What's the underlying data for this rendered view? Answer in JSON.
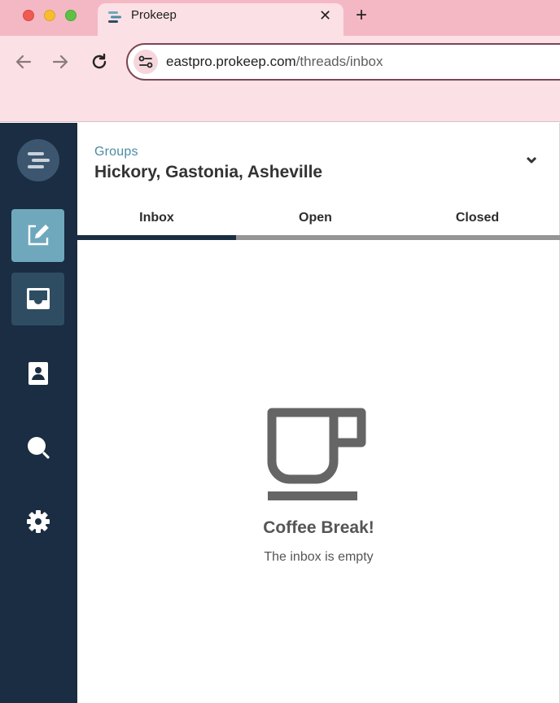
{
  "browser": {
    "tab_title": "Prokeep",
    "tab_close": "✕",
    "new_tab": "+",
    "url_host": "eastpro.prokeep.com",
    "url_path": "/threads/inbox"
  },
  "header": {
    "groups_label": "Groups",
    "group_name": "Hickory, Gastonia, Asheville"
  },
  "tabs": [
    {
      "label": "Inbox",
      "active": true
    },
    {
      "label": "Open",
      "active": false
    },
    {
      "label": "Closed",
      "active": false
    }
  ],
  "empty_state": {
    "icon": "coffee-cup-icon",
    "title": "Coffee Break!",
    "subtitle": "The inbox is empty"
  },
  "sidebar": {
    "items": [
      {
        "icon": "compose-icon",
        "active": true
      },
      {
        "icon": "inbox-icon",
        "active": false
      },
      {
        "icon": "contacts-icon",
        "active": false
      },
      {
        "icon": "search-icon",
        "active": false
      },
      {
        "icon": "gear-icon",
        "active": false
      }
    ]
  },
  "colors": {
    "sidebar_bg": "#1a2d42",
    "compose_active": "#6fa8bd",
    "inbox_active": "#2f4d62",
    "accent": "#4b8ba3",
    "chrome_tabstrip": "#f4b8c4",
    "chrome_toolbar": "#fbe0e5"
  }
}
